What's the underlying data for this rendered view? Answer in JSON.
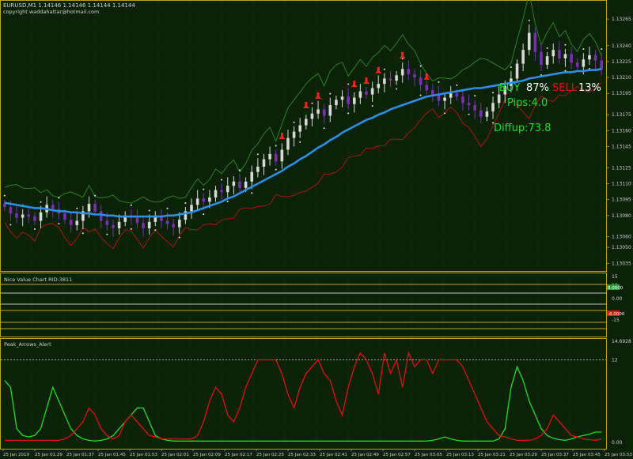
{
  "header": {
    "symbol_line": "EURUSD,M1  1.14146 1.14146 1.14144 1.14144",
    "copyright": "copyright waddahattar@hotmail.com"
  },
  "overlay": {
    "buy_label": "BUY",
    "buy_value": "87%",
    "sell_label": "SELL",
    "sell_value": "13%",
    "pips": "Pips:4.0",
    "diffup": "Diffup:73.8"
  },
  "colors": {
    "background": "#0b2208",
    "grid": "#1f4b1a",
    "axis": "#c0a020",
    "bull_candle": "#d8d8d8",
    "bear_candle": "#7a2fb5",
    "ma": "#2f8fe6",
    "band_upper": "#2e8b22",
    "band_lower": "#b01818",
    "green_line": "#22dd22",
    "red_line": "#e01010",
    "buy_text": "#22dd22",
    "sell_text": "#e01010"
  },
  "chart_data": [
    {
      "type": "candlestick",
      "title": "EURUSD,M1",
      "y_ticks": [
        "1.13265",
        "1.13240",
        "1.13225",
        "1.13210",
        "1.13195",
        "1.13175",
        "1.13160",
        "1.13145",
        "1.13125",
        "1.13110",
        "1.13095",
        "1.13080",
        "1.13060",
        "1.13050",
        "1.13035"
      ],
      "ylim": [
        1.1303,
        1.1328
      ],
      "close": [
        1.13088,
        1.13082,
        1.13078,
        1.13081,
        1.13079,
        1.13075,
        1.13083,
        1.1309,
        1.13086,
        1.13082,
        1.13076,
        1.13071,
        1.13075,
        1.13084,
        1.13091,
        1.13084,
        1.13075,
        1.13071,
        1.13068,
        1.13074,
        1.1308,
        1.13078,
        1.13073,
        1.13068,
        1.13074,
        1.1308,
        1.13075,
        1.13072,
        1.13069,
        1.13076,
        1.13084,
        1.1309,
        1.13096,
        1.13093,
        1.13097,
        1.13104,
        1.13102,
        1.13108,
        1.13112,
        1.13106,
        1.13112,
        1.13121,
        1.13126,
        1.13133,
        1.13138,
        1.13131,
        1.13142,
        1.13153,
        1.13159,
        1.13165,
        1.13171,
        1.13176,
        1.1318,
        1.13174,
        1.13184,
        1.13189,
        1.13192,
        1.13185,
        1.13191,
        1.13197,
        1.13194,
        1.132,
        1.13204,
        1.13209,
        1.13207,
        1.13212,
        1.13218,
        1.13213,
        1.1321,
        1.13203,
        1.13198,
        1.13194,
        1.13188,
        1.13191,
        1.13195,
        1.13192,
        1.13186,
        1.13184,
        1.13179,
        1.13173,
        1.13178,
        1.13186,
        1.13194,
        1.13202,
        1.13209,
        1.13223,
        1.13236,
        1.13252,
        1.13234,
        1.13222,
        1.1323,
        1.13236,
        1.13228,
        1.13232,
        1.13224,
        1.1322,
        1.13227,
        1.13231,
        1.13226,
        1.13218
      ],
      "ma": [
        1.13092,
        1.13091,
        1.1309,
        1.13089,
        1.13088,
        1.13087,
        1.13087,
        1.13086,
        1.13085,
        1.13084,
        1.13084,
        1.13083,
        1.13083,
        1.13082,
        1.13082,
        1.13081,
        1.13081,
        1.1308,
        1.1308,
        1.13079,
        1.13079,
        1.13079,
        1.13079,
        1.13079,
        1.13079,
        1.13079,
        1.13079,
        1.1308,
        1.1308,
        1.13081,
        1.13082,
        1.13083,
        1.13085,
        1.13087,
        1.13089,
        1.13091,
        1.13093,
        1.13096,
        1.13098,
        1.13101,
        1.13104,
        1.13107,
        1.1311,
        1.13113,
        1.13116,
        1.13119,
        1.13122,
        1.13126,
        1.13129,
        1.13133,
        1.13136,
        1.1314,
        1.13144,
        1.13147,
        1.13151,
        1.13154,
        1.13158,
        1.13161,
        1.13164,
        1.13167,
        1.1317,
        1.13172,
        1.13175,
        1.13177,
        1.1318,
        1.13182,
        1.13184,
        1.13186,
        1.13188,
        1.1319,
        1.13192,
        1.13193,
        1.13194,
        1.13195,
        1.13196,
        1.13197,
        1.13198,
        1.13199,
        1.132,
        1.132,
        1.13201,
        1.13202,
        1.13203,
        1.13204,
        1.13205,
        1.13206,
        1.13207,
        1.13209,
        1.1321,
        1.13211,
        1.13212,
        1.13213,
        1.13214,
        1.13215,
        1.13215,
        1.13216,
        1.13216,
        1.13217,
        1.13217,
        1.13218
      ],
      "x_ticks": [
        "25 Jan 2019",
        "25 Jan 01:29",
        "25 Jan 01:37",
        "25 Jan 01:45",
        "25 Jan 01:53",
        "25 Jan 02:01",
        "25 Jan 02:09",
        "25 Jan 02:17",
        "25 Jan 02:25",
        "25 Jan 02:33",
        "25 Jan 02:41",
        "25 Jan 02:49",
        "25 Jan 02:57",
        "25 Jan 03:05",
        "25 Jan 03:13",
        "25 Jan 03:21",
        "25 Jan 03:29",
        "25 Jan 03:37",
        "25 Jan 03:45",
        "25 Jan 03:53"
      ]
    },
    {
      "type": "table",
      "title": "Nice Value Chart RID:3811",
      "y_ticks": [
        "15",
        "10",
        "0.00",
        "-10",
        "-15"
      ],
      "badges": [
        "8.0000",
        "-8.0000"
      ]
    },
    {
      "type": "line",
      "title": "Peak_Arrows_Alert",
      "y_ticks": [
        "14.6928",
        "12",
        "0.00"
      ],
      "ylim": [
        0,
        14.6928
      ],
      "dashed_level": 12,
      "series": [
        {
          "values": [
            9,
            8,
            2,
            1,
            0.8,
            1,
            2,
            5,
            8,
            6,
            4,
            2,
            1,
            0.5,
            0.3,
            0.2,
            0.3,
            0.5,
            1,
            2,
            3,
            4,
            5,
            5,
            3,
            1,
            0.5,
            0.3,
            0.2,
            0.2,
            0.2,
            0.2,
            0.2,
            0.2,
            0.2,
            0.2,
            0.2,
            0.2,
            0.2,
            0.2,
            0.2,
            0.2,
            0.2,
            0.2,
            0.2,
            0.2,
            0.2,
            0.2,
            0.2,
            0.2,
            0.2,
            0.2,
            0.2,
            0.2,
            0.2,
            0.2,
            0.2,
            0.2,
            0.2,
            0.2,
            0.2,
            0.2,
            0.2,
            0.2,
            0.2,
            0.2,
            0.2,
            0.2,
            0.2,
            0.2,
            0.2,
            0.3,
            0.5,
            0.8,
            0.5,
            0.3,
            0.2,
            0.2,
            0.2,
            0.2,
            0.2,
            0.2,
            0.5,
            2,
            8,
            11,
            9,
            6,
            4,
            2,
            1,
            0.6,
            0.4,
            0.3,
            0.5,
            0.8,
            1,
            1.2,
            1.5,
            1.5
          ]
        },
        {
          "values": [
            0.3,
            0.3,
            0.3,
            0.3,
            0.3,
            0.3,
            0.3,
            0.3,
            0.3,
            0.3,
            0.5,
            1,
            2,
            3,
            5,
            4,
            2,
            1,
            0.5,
            1,
            3,
            4,
            3,
            2,
            1,
            0.8,
            0.5,
            0.5,
            0.5,
            0.5,
            0.5,
            0.5,
            1,
            3,
            6,
            8,
            7,
            4,
            3,
            5,
            8,
            10,
            12,
            12,
            12,
            12,
            10,
            7,
            5,
            8,
            10,
            11,
            12,
            10,
            9,
            6,
            4,
            8,
            11,
            13,
            12,
            10,
            7,
            13,
            10,
            12,
            8,
            13,
            11,
            12,
            12,
            10,
            12,
            12,
            12,
            12,
            11,
            9,
            7,
            5,
            3,
            2,
            1,
            0.8,
            0.5,
            0.3,
            0.3,
            0.3,
            0.5,
            1,
            2,
            4,
            3,
            2,
            1,
            0.8,
            0.5,
            0.4,
            0.3,
            0.5
          ]
        }
      ]
    }
  ]
}
